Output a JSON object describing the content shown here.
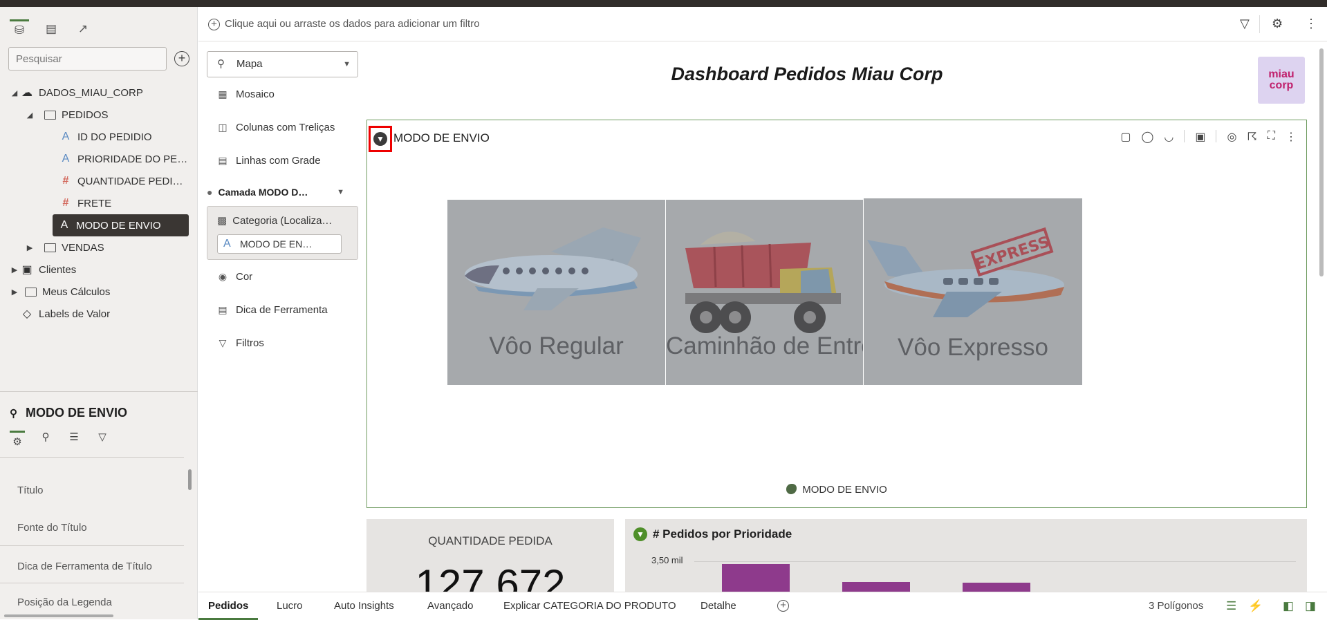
{
  "left_panel": {
    "tabs": [
      "data-icon",
      "visualizations-icon",
      "analytics-icon"
    ],
    "search": {
      "placeholder": "Pesquisar",
      "value": ""
    },
    "tree": {
      "root": "DADOS_MIAU_CORP",
      "folder": "PEDIDOS",
      "fields": [
        {
          "label": "ID DO PEDIDIO",
          "type": "A"
        },
        {
          "label": "PRIORIDADE DO PE…",
          "type": "A"
        },
        {
          "label": "QUANTIDADE PEDI…",
          "type": "#"
        },
        {
          "label": "FRETE",
          "type": "#"
        },
        {
          "label": "MODO DE ENVIO",
          "type": "A"
        }
      ],
      "vendas": "VENDAS",
      "clientes": "Clientes",
      "calculos": "Meus Cálculos",
      "labels": "Labels de Valor"
    },
    "properties": {
      "title": "MODO DE ENVIO",
      "items": [
        "Título",
        "Fonte do Título",
        "Dica de Ferramenta de Título",
        "Posição da Legenda"
      ]
    }
  },
  "filter_bar": {
    "placeholder": "Clique aqui ou arraste os dados para adicionar um filtro"
  },
  "grammar": {
    "viz_type": "Mapa",
    "options": [
      "Mosaico",
      "Colunas com Treliças",
      "Linhas com Grade"
    ],
    "layer": "Camada MODO D…",
    "category_label": "Categoria (Localiza…",
    "category_value": "MODO DE EN…",
    "sections": [
      "Cor",
      "Dica de Ferramenta",
      "Filtros"
    ]
  },
  "canvas": {
    "title": "Dashboard Pedidos Miau Corp",
    "logo_text": [
      "miau",
      "corp"
    ],
    "map": {
      "title": "MODO DE ENVIO",
      "tiles": [
        "Vôo Regular",
        "Caminhão de Entrega",
        "Vôo Expresso"
      ],
      "stamp": "EXPRESS",
      "legend": "MODO DE ENVIO"
    },
    "kpi": {
      "title": "QUANTIDADE PEDIDA",
      "value": "127.672"
    },
    "bar": {
      "title": "# Pedidos por Prioridade",
      "tick": "3,50 mil",
      "bar_color": "#8e3a8c"
    }
  },
  "bottom": {
    "tabs": [
      "Pedidos",
      "Lucro",
      "Auto Insights",
      "Avançado",
      "Explicar CATEGORIA DO PRODUTO",
      "Detalhe"
    ],
    "status": "3 Polígonos"
  }
}
